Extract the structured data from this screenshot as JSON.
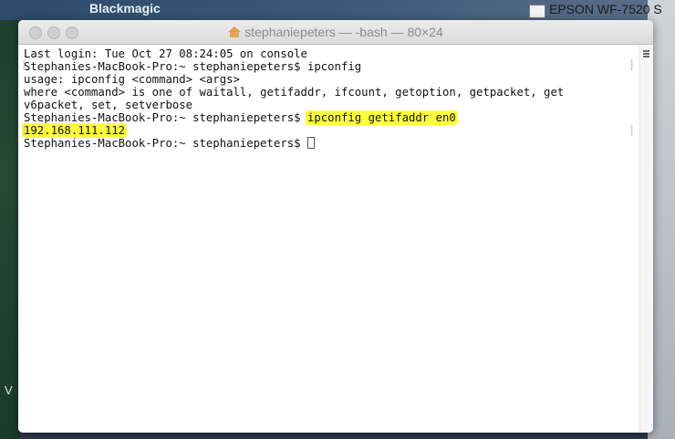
{
  "desktop": {
    "top_left_label": "Blackmagic",
    "top_right_label": "EPSON WF-7520 S",
    "left_edge_glyph": "V"
  },
  "window": {
    "title": "stephaniepeters — -bash — 80×24",
    "title_icon": "home-icon"
  },
  "terminal": {
    "lines": [
      "Last login: Tue Oct 27 08:24:05 on console",
      "Stephanies-MacBook-Pro:~ stephaniepeters$ ipconfig",
      "usage: ipconfig <command> <args>",
      "where <command> is one of waitall, getifaddr, ifcount, getoption, getpacket, get",
      "v6packet, set, setverbose",
      "Stephanies-MacBook-Pro:~ stephaniepeters$ ",
      "Stephanies-MacBook-Pro:~ stephaniepeters$ "
    ],
    "highlighted_command": "ipconfig getifaddr en0",
    "ip_output": "192.168.111.112",
    "highlight_color": "#ffff3a"
  }
}
